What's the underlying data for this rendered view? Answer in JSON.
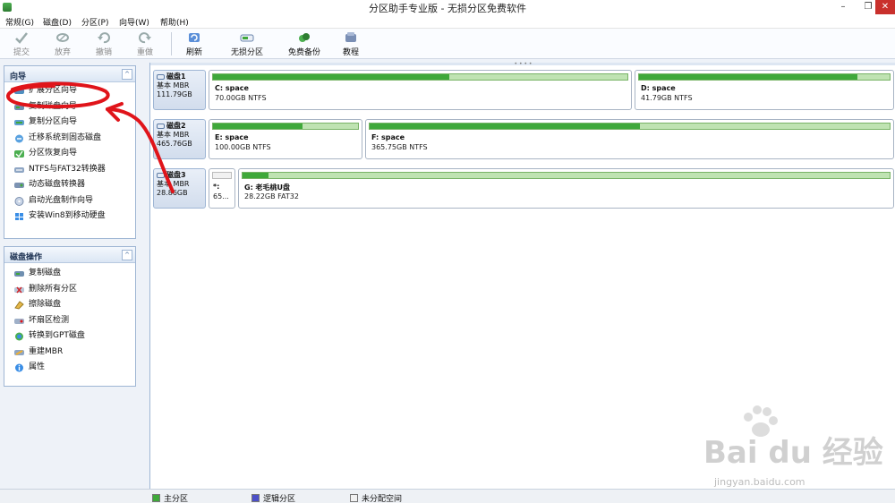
{
  "window": {
    "title": "分区助手专业版 - 无损分区免费软件",
    "min": "–",
    "max": "❐",
    "close": "✕"
  },
  "menu": [
    "常规(G)",
    "磁盘(D)",
    "分区(P)",
    "向导(W)",
    "帮助(H)"
  ],
  "toolbar": {
    "submit": "提交",
    "discard": "放弃",
    "undo": "撤销",
    "redo": "重做",
    "refresh": "刷新",
    "lossless": "无损分区",
    "backup": "免费备份",
    "tutorial": "教程"
  },
  "wizard_panel": {
    "title": "向导",
    "collapse": "^",
    "items": [
      {
        "label": "扩展分区向导",
        "icon": "expand-partition-icon"
      },
      {
        "label": "复制磁盘向导",
        "icon": "copy-disk-icon"
      },
      {
        "label": "复制分区向导",
        "icon": "copy-partition-icon"
      },
      {
        "label": "迁移系统到固态磁盘",
        "icon": "migrate-ssd-icon"
      },
      {
        "label": "分区恢复向导",
        "icon": "partition-recovery-icon"
      },
      {
        "label": "NTFS与FAT32转换器",
        "icon": "ntfs-fat32-icon"
      },
      {
        "label": "动态磁盘转换器",
        "icon": "dynamic-disk-icon"
      },
      {
        "label": "启动光盘制作向导",
        "icon": "boot-cd-icon"
      },
      {
        "label": "安装Win8到移动硬盘",
        "icon": "win8-usb-icon"
      }
    ]
  },
  "disk_ops_panel": {
    "title": "磁盘操作",
    "collapse": "^",
    "items": [
      {
        "label": "复制磁盘",
        "icon": "copy-disk-icon"
      },
      {
        "label": "删除所有分区",
        "icon": "delete-all-icon"
      },
      {
        "label": "擦除磁盘",
        "icon": "wipe-disk-icon"
      },
      {
        "label": "坏扇区检测",
        "icon": "bad-sector-icon"
      },
      {
        "label": "转换到GPT磁盘",
        "icon": "convert-gpt-icon"
      },
      {
        "label": "重建MBR",
        "icon": "rebuild-mbr-icon"
      },
      {
        "label": "属性",
        "icon": "properties-icon"
      }
    ]
  },
  "disks": [
    {
      "name": "磁盘1",
      "type": "基本 MBR",
      "size": "111.79GB",
      "partitions": [
        {
          "letter": "C: space",
          "size": "70.00GB NTFS",
          "used": 0.57
        },
        {
          "letter": "D: space",
          "size": "41.79GB NTFS",
          "used": 0.87
        }
      ]
    },
    {
      "name": "磁盘2",
      "type": "基本 MBR",
      "size": "465.76GB",
      "partitions": [
        {
          "letter": "E: space",
          "size": "100.00GB NTFS",
          "used": 0.62
        },
        {
          "letter": "F: space",
          "size": "365.75GB NTFS",
          "used": 0.52
        }
      ]
    },
    {
      "name": "磁盘3",
      "type": "基本 MBR",
      "size": "28.86GB",
      "partitions": [
        {
          "letter": "*:",
          "size": "65...",
          "used": 0.0
        },
        {
          "letter": "G: 老毛桃U盘",
          "size": "28.22GB FAT32",
          "used": 0.04
        }
      ]
    }
  ],
  "legend": [
    {
      "label": "主分区",
      "color": "#3fa83a"
    },
    {
      "label": "逻辑分区",
      "color": "#4b4fc8"
    },
    {
      "label": "未分配空间",
      "color": "#f1f1f1"
    }
  ],
  "watermark": {
    "text": "Bai du 经验",
    "sub": "jingyan.baidu.com"
  },
  "colors": {
    "annotation": "#e0141a",
    "primary_used": "#3fa83a",
    "primary_free": "#bfe3b2"
  }
}
